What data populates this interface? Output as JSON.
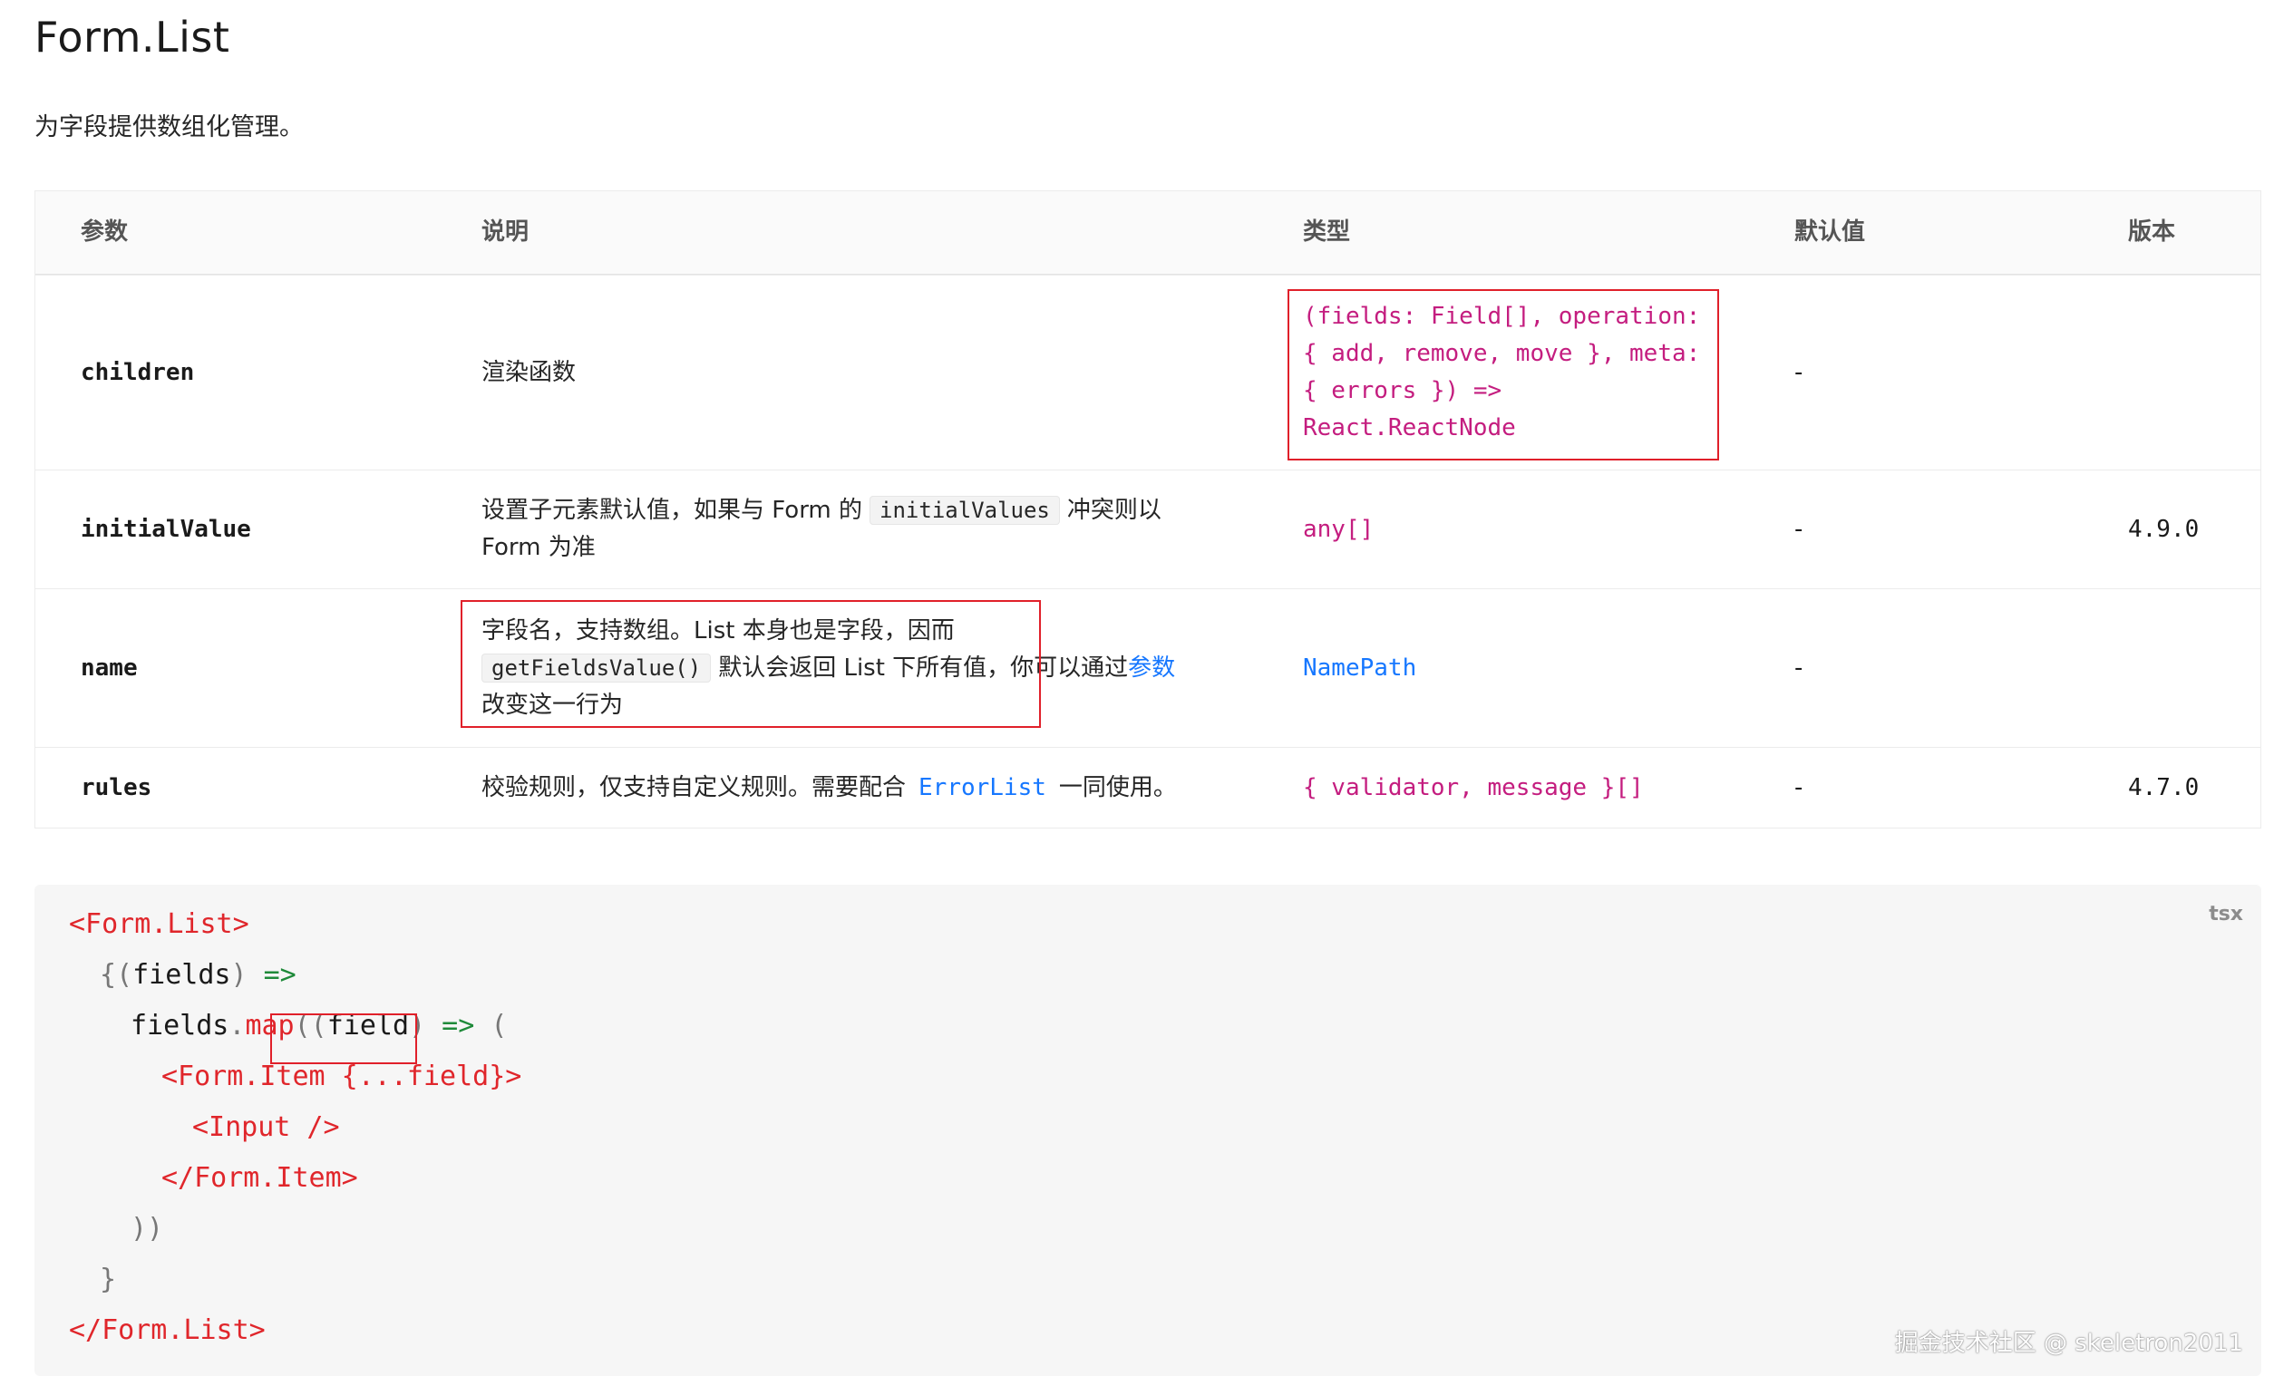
{
  "page": {
    "title": "Form.List",
    "description": "为字段提供数组化管理。"
  },
  "table": {
    "headers": [
      "参数",
      "说明",
      "类型",
      "默认值",
      "版本"
    ],
    "rows": [
      {
        "param": "children",
        "desc": "渲染函数",
        "type_lines": [
          "(fields: Field[], operation:",
          "{ add, remove, move }, meta:",
          "{ errors }) =>",
          "React.ReactNode"
        ],
        "default": "-",
        "version": ""
      },
      {
        "param": "initialValue",
        "desc_part1": "设置子元素默认值，如果与 Form 的",
        "desc_code": "initialValues",
        "desc_part2": "冲突则以",
        "desc_line2": "Form 为准",
        "type": "any[]",
        "default": "-",
        "version": "4.9.0"
      },
      {
        "param": "name",
        "desc_line1": "字段名，支持数组。List 本身也是字段，因而",
        "desc_code": "getFieldsValue()",
        "desc_mid": "默认会返回 List 下所有值，你可以通过",
        "desc_link": "参数",
        "desc_line3": "改变这一行为",
        "type": "NamePath",
        "default": "-",
        "version": ""
      },
      {
        "param": "rules",
        "desc_part1": "校验规则，仅支持自定义规则。需要配合",
        "desc_link": "ErrorList",
        "desc_part2": "一同使用。",
        "type": "{ validator, message }[]",
        "default": "-",
        "version": "4.7.0"
      }
    ]
  },
  "code": {
    "lang": "tsx",
    "watermark": "掘金技术社区 @ skeletron2011",
    "lines": {
      "l1": "<Form.List>",
      "l2_brace": "{",
      "l2_paren": "(",
      "l2_ident": "fields",
      "l2_close": ")",
      "l2_arrow": " =>",
      "l3_obj": "fields",
      "l3_dot": ".",
      "l3_method": "map",
      "l3_paren": "((",
      "l3_ident": "field",
      "l3_close": ")",
      "l3_arrow": " =>",
      "l3_open": " (",
      "l4": "<Form.Item {...field}>",
      "l5": "<Input />",
      "l6": "</Form.Item>",
      "l7": "))",
      "l8": "}",
      "l9": "</Form.List>"
    }
  }
}
